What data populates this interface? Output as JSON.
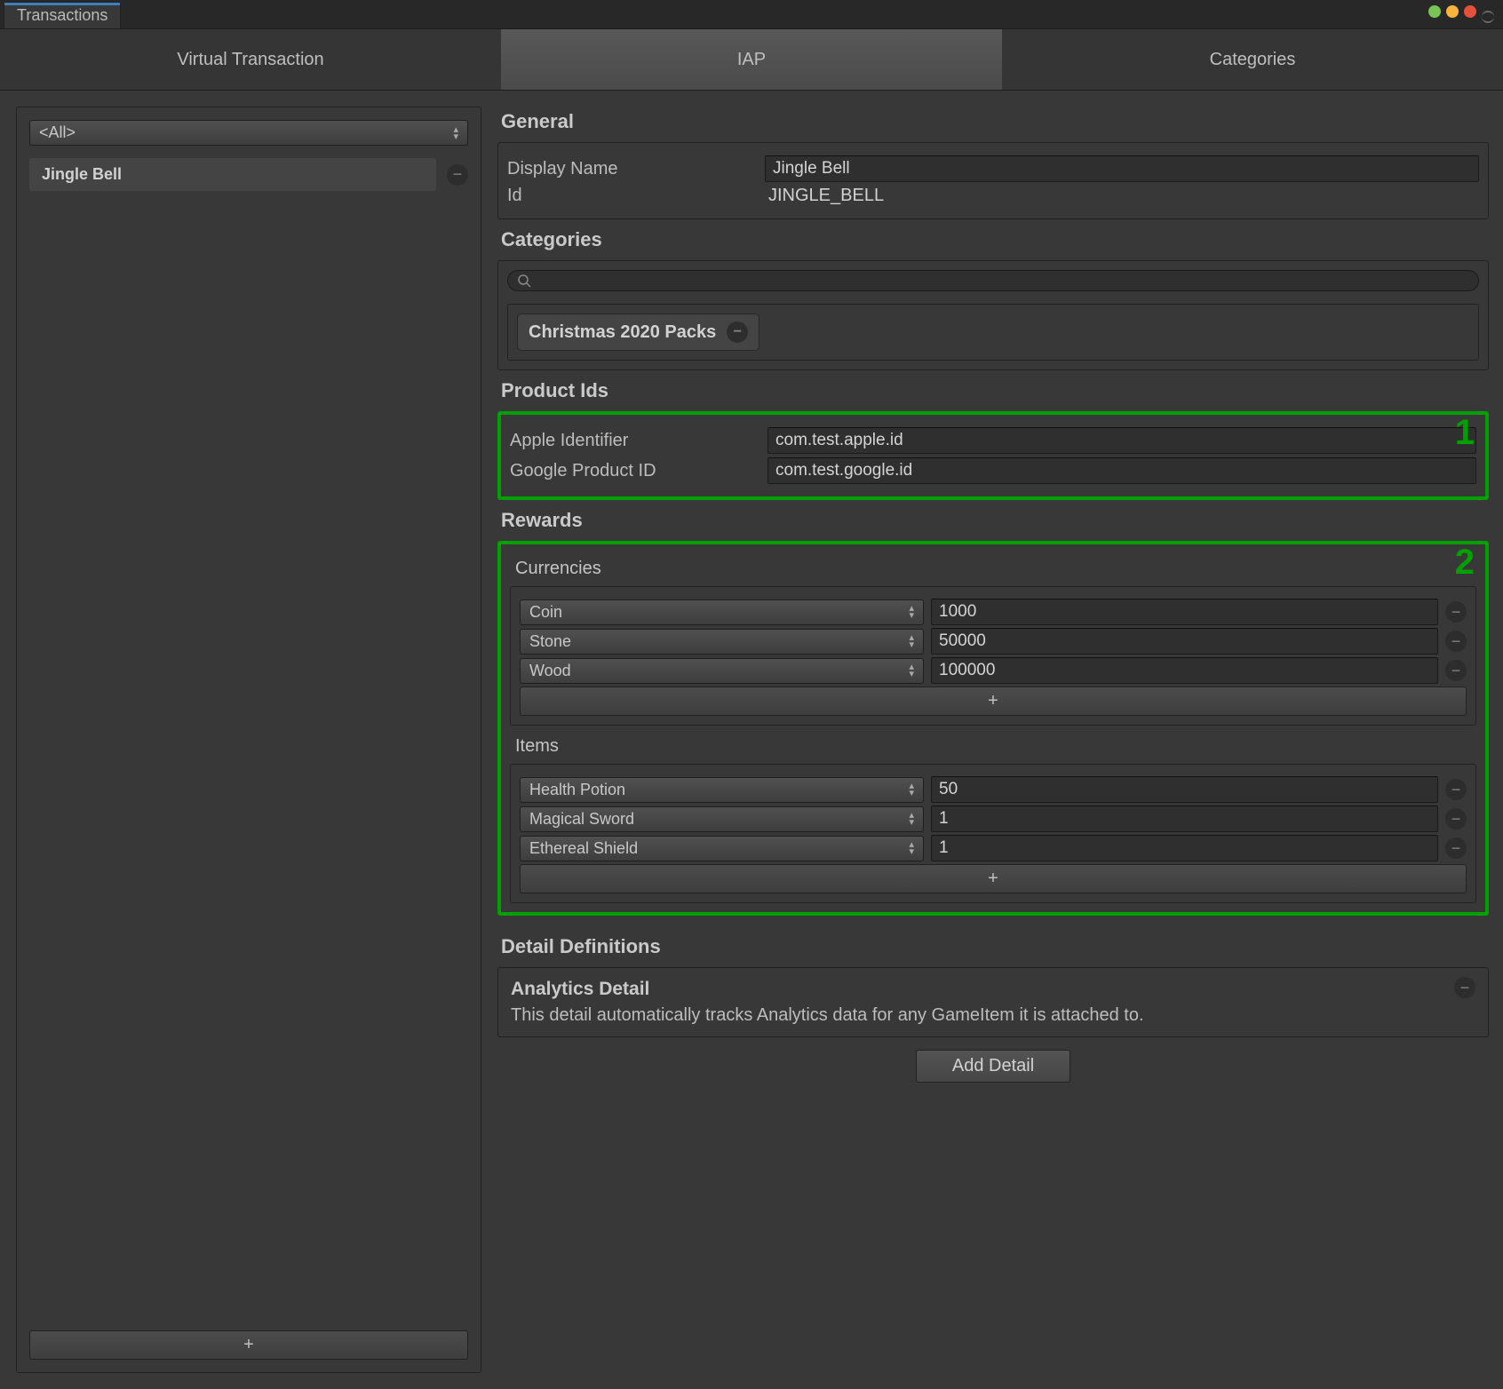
{
  "window": {
    "tab": "Transactions"
  },
  "tabs": {
    "virtual": "Virtual Transaction",
    "iap": "IAP",
    "categories": "Categories"
  },
  "sidebar": {
    "filter": "<All>",
    "items": [
      {
        "label": "Jingle Bell"
      }
    ],
    "add": "+"
  },
  "general": {
    "title": "General",
    "display_name_label": "Display Name",
    "display_name": "Jingle Bell",
    "id_label": "Id",
    "id": "JINGLE_BELL"
  },
  "categories": {
    "title": "Categories",
    "tags": [
      "Christmas 2020 Packs"
    ]
  },
  "product_ids": {
    "title": "Product Ids",
    "apple_label": "Apple Identifier",
    "apple": "com.test.apple.id",
    "google_label": "Google Product ID",
    "google": "com.test.google.id",
    "marker": "1"
  },
  "rewards": {
    "title": "Rewards",
    "marker": "2",
    "currencies": {
      "title": "Currencies",
      "rows": [
        {
          "name": "Coin",
          "value": "1000"
        },
        {
          "name": "Stone",
          "value": "50000"
        },
        {
          "name": "Wood",
          "value": "100000"
        }
      ],
      "add": "+"
    },
    "items": {
      "title": "Items",
      "rows": [
        {
          "name": "Health Potion",
          "value": "50"
        },
        {
          "name": "Magical Sword",
          "value": "1"
        },
        {
          "name": "Ethereal Shield",
          "value": "1"
        }
      ],
      "add": "+"
    }
  },
  "detail_defs": {
    "title": "Detail Definitions",
    "analytics_title": "Analytics Detail",
    "analytics_desc": "This detail automatically tracks Analytics data for any GameItem it is attached to.",
    "add_btn": "Add Detail"
  }
}
